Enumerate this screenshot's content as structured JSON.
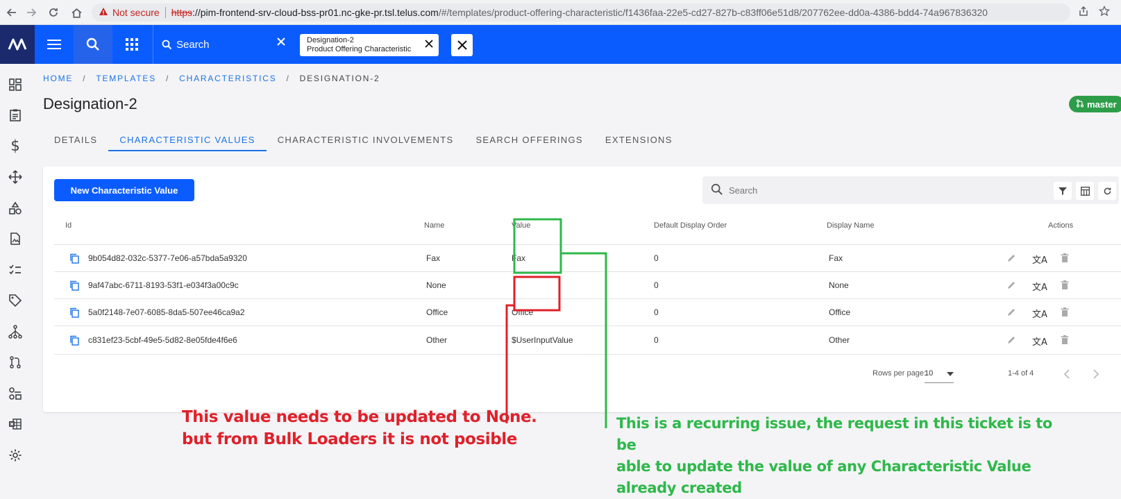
{
  "browser": {
    "not_secure": "Not secure",
    "url_https": "https",
    "url_host": "://pim-frontend-srv-cloud-bss-pr01.nc-gke-pr.tsl.telus.com",
    "url_path": "/#/templates/product-offering-characteristic/f1436faa-22e5-cd27-827b-c83ff06e51d8/207762ee-dd0a-4386-bdd4-74a967836320"
  },
  "header": {
    "search_label": "Search",
    "open_tab": {
      "title": "Designation-2",
      "subtitle": "Product Offering Characteristic"
    }
  },
  "breadcrumb": [
    "HOME",
    "TEMPLATES",
    "CHARACTERISTICS",
    "DESIGNATION-2"
  ],
  "page_title": "Designation-2",
  "branch_badge": "master",
  "tabs": [
    "DETAILS",
    "CHARACTERISTIC VALUES",
    "CHARACTERISTIC INVOLVEMENTS",
    "SEARCH OFFERINGS",
    "EXTENSIONS"
  ],
  "active_tab": "CHARACTERISTIC VALUES",
  "toolbar": {
    "new_button": "New Characteristic Value",
    "search_placeholder": "Search"
  },
  "table": {
    "columns": [
      "Id",
      "Name",
      "Value",
      "Default Display Order",
      "Display Name",
      "Actions"
    ],
    "rows": [
      {
        "id": "9b054d82-032c-5377-7e06-a57bda5a9320",
        "name": "Fax",
        "value": "Fax",
        "order": "0",
        "display": "Fax"
      },
      {
        "id": "9af47abc-6711-8193-53f1-e034f3a00c9c",
        "name": "None",
        "value": "",
        "order": "0",
        "display": "None"
      },
      {
        "id": "5a0f2148-7e07-6085-8da5-507ee46ca9a2",
        "name": "Office",
        "value": "Office",
        "order": "0",
        "display": "Office"
      },
      {
        "id": "c831ef23-5cbf-49e5-5d82-8e05fde4f6e6",
        "name": "Other",
        "value": "$UserInputValue",
        "order": "0",
        "display": "Other"
      }
    ]
  },
  "pagination": {
    "rows_per_page_label": "Rows per page:",
    "rows_per_page": "10",
    "range": "1-4 of 4"
  },
  "annotations": {
    "red": [
      "This value needs to be updated to None.",
      "but from Bulk Loaders it is not posible"
    ],
    "green": [
      "This is a recurring issue, the request in this ticket is to be",
      "able to update the value of any Characteristic Value",
      "already created"
    ],
    "red_color": "#e0202a",
    "green_color": "#2eb84a"
  },
  "colors": {
    "primary": "#0b5cff",
    "link": "#1a73e8",
    "badge": "#2e9d4a"
  }
}
